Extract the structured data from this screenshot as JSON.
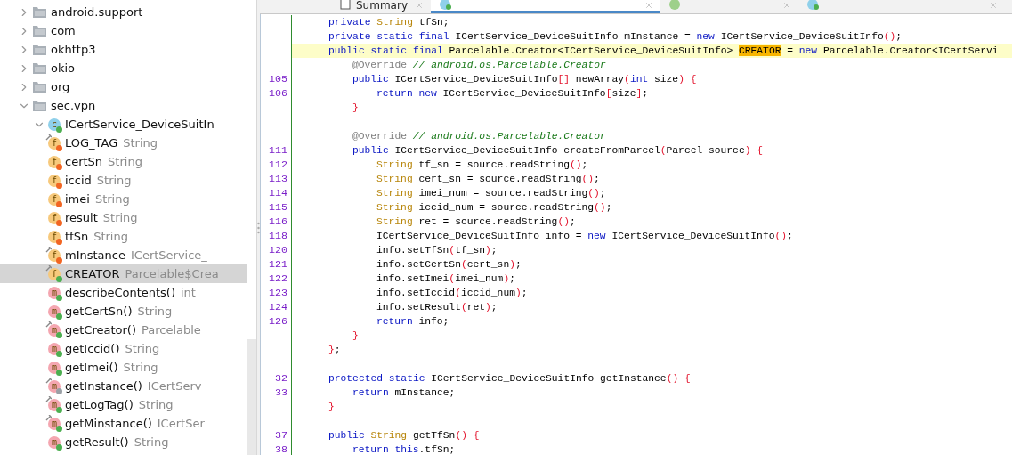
{
  "project_tree": [
    {
      "kind": "package",
      "label": "android.support",
      "expanded": false
    },
    {
      "kind": "package",
      "label": "com",
      "expanded": false
    },
    {
      "kind": "package",
      "label": "okhttp3",
      "expanded": false
    },
    {
      "kind": "package",
      "label": "okio",
      "expanded": false
    },
    {
      "kind": "package",
      "label": "org",
      "expanded": false
    },
    {
      "kind": "package",
      "label": "sec.vpn",
      "expanded": true,
      "children": [
        {
          "kind": "class",
          "label": "ICertService_DeviceSuitIn",
          "letter": "c",
          "color": "#4caf50",
          "expanded": true,
          "children": [
            {
              "kind": "field",
              "letter": "f",
              "label": "LOG_TAG",
              "type": "String",
              "static": true,
              "color": "#f26522",
              "selected": false
            },
            {
              "kind": "field",
              "letter": "f",
              "label": "certSn",
              "type": "String",
              "static": false,
              "color": "#f26522",
              "selected": false
            },
            {
              "kind": "field",
              "letter": "f",
              "label": "iccid",
              "type": "String",
              "static": false,
              "color": "#f26522",
              "selected": false
            },
            {
              "kind": "field",
              "letter": "f",
              "label": "imei",
              "type": "String",
              "static": false,
              "color": "#f26522",
              "selected": false
            },
            {
              "kind": "field",
              "letter": "f",
              "label": "result",
              "type": "String",
              "static": false,
              "color": "#f26522",
              "selected": false
            },
            {
              "kind": "field",
              "letter": "f",
              "label": "tfSn",
              "type": "String",
              "static": false,
              "color": "#f26522",
              "selected": false
            },
            {
              "kind": "field",
              "letter": "f",
              "label": "mInstance",
              "type": "ICertService_",
              "static": true,
              "color": "#f26522",
              "selected": false
            },
            {
              "kind": "field",
              "letter": "f",
              "label": "CREATOR",
              "type": "Parcelable$Crea",
              "static": true,
              "color": "#4caf50",
              "selected": true
            },
            {
              "kind": "method",
              "letter": "m",
              "label": "describeContents()",
              "type": "int",
              "static": false,
              "color": "#4caf50",
              "selected": false
            },
            {
              "kind": "method",
              "letter": "m",
              "label": "getCertSn()",
              "type": "String",
              "static": false,
              "color": "#4caf50",
              "selected": false
            },
            {
              "kind": "method",
              "letter": "m",
              "label": "getCreator()",
              "type": "Parcelable",
              "static": true,
              "color": "#4caf50",
              "selected": false
            },
            {
              "kind": "method",
              "letter": "m",
              "label": "getIccid()",
              "type": "String",
              "static": false,
              "color": "#4caf50",
              "selected": false
            },
            {
              "kind": "method",
              "letter": "m",
              "label": "getImei()",
              "type": "String",
              "static": false,
              "color": "#4caf50",
              "selected": false
            },
            {
              "kind": "method",
              "letter": "m",
              "label": "getInstance()",
              "type": "ICertServ",
              "static": true,
              "color": "#9aa0a6",
              "selected": false
            },
            {
              "kind": "method",
              "letter": "m",
              "label": "getLogTag()",
              "type": "String",
              "static": true,
              "color": "#4caf50",
              "selected": false
            },
            {
              "kind": "method",
              "letter": "m",
              "label": "getMinstance()",
              "type": "ICertSer",
              "static": true,
              "color": "#4caf50",
              "selected": false
            },
            {
              "kind": "method",
              "letter": "m",
              "label": "getResult()",
              "type": "String",
              "static": false,
              "color": "#4caf50",
              "selected": false
            }
          ]
        }
      ]
    }
  ],
  "editor_tabs": [
    {
      "kind": "document",
      "label": "Summary",
      "selected": false
    },
    {
      "kind": "class",
      "selected": true
    },
    {
      "kind": "progress",
      "selected": false
    },
    {
      "kind": "class",
      "selected": false
    }
  ],
  "code_lines": [
    {
      "kind": "code",
      "tokens": [
        {
          "kind": "keyword",
          "text": "private "
        },
        {
          "kind": "type",
          "text": "String "
        },
        {
          "kind": "plain",
          "text": "tfSn;"
        }
      ]
    },
    {
      "kind": "code",
      "tokens": [
        {
          "kind": "keyword",
          "text": "private static final "
        },
        {
          "kind": "plain",
          "text": "ICertService_DeviceSuitInfo mInstance = "
        },
        {
          "kind": "keyword",
          "text": "new "
        },
        {
          "kind": "plain",
          "text": "ICertService_DeviceSuitInfo"
        },
        {
          "kind": "bracket",
          "text": "()"
        },
        {
          "kind": "plain",
          "text": ";"
        }
      ]
    },
    {
      "kind": "code",
      "highlighted": true,
      "tokens": [
        {
          "kind": "keyword",
          "text": "public static final "
        },
        {
          "kind": "plain",
          "text": "Parcelable.Creator<ICertService_DeviceSuitInfo> "
        },
        {
          "kind": "match",
          "text": "CREATOR"
        },
        {
          "kind": "plain",
          "text": " = "
        },
        {
          "kind": "keyword",
          "text": "new "
        },
        {
          "kind": "plain",
          "text": "Parcelable.Creator<ICertServi"
        }
      ],
      "children": [
        {
          "kind": "code",
          "tokens": [
            {
              "kind": "annotation",
              "text": "@Override "
            },
            {
              "kind": "comment",
              "text": "// android.os.Parcelable.Creator"
            }
          ]
        },
        {
          "kind": "code",
          "number": "105",
          "tokens": [
            {
              "kind": "keyword",
              "text": "public "
            },
            {
              "kind": "plain",
              "text": "ICertService_DeviceSuitInfo"
            },
            {
              "kind": "bracket",
              "text": "[]"
            },
            {
              "kind": "plain",
              "text": " newArray"
            },
            {
              "kind": "bracket",
              "text": "("
            },
            {
              "kind": "keyword",
              "text": "int "
            },
            {
              "kind": "plain",
              "text": "size"
            },
            {
              "kind": "bracket",
              "text": ") {"
            }
          ],
          "children": [
            {
              "kind": "code",
              "number": "106",
              "tokens": [
                {
                  "kind": "keyword",
                  "text": "return new "
                },
                {
                  "kind": "plain",
                  "text": "ICertService_DeviceSuitInfo"
                },
                {
                  "kind": "bracket",
                  "text": "["
                },
                {
                  "kind": "plain",
                  "text": "size"
                },
                {
                  "kind": "bracket",
                  "text": "]"
                },
                {
                  "kind": "plain",
                  "text": ";"
                }
              ]
            }
          ]
        },
        {
          "kind": "code",
          "tokens": [
            {
              "kind": "bracket",
              "text": "}"
            }
          ]
        },
        {
          "kind": "blank"
        },
        {
          "kind": "code",
          "tokens": [
            {
              "kind": "annotation",
              "text": "@Override "
            },
            {
              "kind": "comment",
              "text": "// android.os.Parcelable.Creator"
            }
          ]
        },
        {
          "kind": "code",
          "number": "111",
          "tokens": [
            {
              "kind": "keyword",
              "text": "public "
            },
            {
              "kind": "plain",
              "text": "ICertService_DeviceSuitInfo createFromParcel"
            },
            {
              "kind": "bracket",
              "text": "("
            },
            {
              "kind": "plain",
              "text": "Parcel source"
            },
            {
              "kind": "bracket",
              "text": ") {"
            }
          ],
          "children": [
            {
              "kind": "code",
              "number": "112",
              "tokens": [
                {
                  "kind": "type",
                  "text": "String "
                },
                {
                  "kind": "plain",
                  "text": "tf_sn = source.readString"
                },
                {
                  "kind": "bracket",
                  "text": "()"
                },
                {
                  "kind": "plain",
                  "text": ";"
                }
              ]
            },
            {
              "kind": "code",
              "number": "113",
              "tokens": [
                {
                  "kind": "type",
                  "text": "String "
                },
                {
                  "kind": "plain",
                  "text": "cert_sn = source.readString"
                },
                {
                  "kind": "bracket",
                  "text": "()"
                },
                {
                  "kind": "plain",
                  "text": ";"
                }
              ]
            },
            {
              "kind": "code",
              "number": "114",
              "tokens": [
                {
                  "kind": "type",
                  "text": "String "
                },
                {
                  "kind": "plain",
                  "text": "imei_num = source.readString"
                },
                {
                  "kind": "bracket",
                  "text": "()"
                },
                {
                  "kind": "plain",
                  "text": ";"
                }
              ]
            },
            {
              "kind": "code",
              "number": "115",
              "tokens": [
                {
                  "kind": "type",
                  "text": "String "
                },
                {
                  "kind": "plain",
                  "text": "iccid_num = source.readString"
                },
                {
                  "kind": "bracket",
                  "text": "()"
                },
                {
                  "kind": "plain",
                  "text": ";"
                }
              ]
            },
            {
              "kind": "code",
              "number": "116",
              "tokens": [
                {
                  "kind": "type",
                  "text": "String "
                },
                {
                  "kind": "plain",
                  "text": "ret = source.readString"
                },
                {
                  "kind": "bracket",
                  "text": "()"
                },
                {
                  "kind": "plain",
                  "text": ";"
                }
              ]
            },
            {
              "kind": "code",
              "number": "118",
              "tokens": [
                {
                  "kind": "plain",
                  "text": "ICertService_DeviceSuitInfo info = "
                },
                {
                  "kind": "keyword",
                  "text": "new "
                },
                {
                  "kind": "plain",
                  "text": "ICertService_DeviceSuitInfo"
                },
                {
                  "kind": "bracket",
                  "text": "()"
                },
                {
                  "kind": "plain",
                  "text": ";"
                }
              ]
            },
            {
              "kind": "code",
              "number": "120",
              "tokens": [
                {
                  "kind": "plain",
                  "text": "info.setTfSn"
                },
                {
                  "kind": "bracket",
                  "text": "("
                },
                {
                  "kind": "plain",
                  "text": "tf_sn"
                },
                {
                  "kind": "bracket",
                  "text": ")"
                },
                {
                  "kind": "plain",
                  "text": ";"
                }
              ]
            },
            {
              "kind": "code",
              "number": "121",
              "tokens": [
                {
                  "kind": "plain",
                  "text": "info.setCertSn"
                },
                {
                  "kind": "bracket",
                  "text": "("
                },
                {
                  "kind": "plain",
                  "text": "cert_sn"
                },
                {
                  "kind": "bracket",
                  "text": ")"
                },
                {
                  "kind": "plain",
                  "text": ";"
                }
              ]
            },
            {
              "kind": "code",
              "number": "122",
              "tokens": [
                {
                  "kind": "plain",
                  "text": "info.setImei"
                },
                {
                  "kind": "bracket",
                  "text": "("
                },
                {
                  "kind": "plain",
                  "text": "imei_num"
                },
                {
                  "kind": "bracket",
                  "text": ")"
                },
                {
                  "kind": "plain",
                  "text": ";"
                }
              ]
            },
            {
              "kind": "code",
              "number": "123",
              "tokens": [
                {
                  "kind": "plain",
                  "text": "info.setIccid"
                },
                {
                  "kind": "bracket",
                  "text": "("
                },
                {
                  "kind": "plain",
                  "text": "iccid_num"
                },
                {
                  "kind": "bracket",
                  "text": ")"
                },
                {
                  "kind": "plain",
                  "text": ";"
                }
              ]
            },
            {
              "kind": "code",
              "number": "124",
              "tokens": [
                {
                  "kind": "plain",
                  "text": "info.setResult"
                },
                {
                  "kind": "bracket",
                  "text": "("
                },
                {
                  "kind": "plain",
                  "text": "ret"
                },
                {
                  "kind": "bracket",
                  "text": ")"
                },
                {
                  "kind": "plain",
                  "text": ";"
                }
              ]
            },
            {
              "kind": "code",
              "number": "126",
              "tokens": [
                {
                  "kind": "keyword",
                  "text": "return "
                },
                {
                  "kind": "plain",
                  "text": "info;"
                }
              ]
            }
          ]
        },
        {
          "kind": "code",
          "tokens": [
            {
              "kind": "bracket",
              "text": "}"
            }
          ]
        }
      ]
    },
    {
      "kind": "code",
      "tokens": [
        {
          "kind": "bracket",
          "text": "}"
        },
        {
          "kind": "plain",
          "text": ";"
        }
      ]
    },
    {
      "kind": "blank"
    },
    {
      "kind": "code",
      "number": "32",
      "tokens": [
        {
          "kind": "keyword",
          "text": "protected static "
        },
        {
          "kind": "plain",
          "text": "ICertService_DeviceSuitInfo getInstance"
        },
        {
          "kind": "bracket",
          "text": "() {"
        }
      ],
      "children": [
        {
          "kind": "code",
          "number": "33",
          "tokens": [
            {
              "kind": "keyword",
              "text": "return "
            },
            {
              "kind": "plain",
              "text": "mInstance;"
            }
          ]
        }
      ]
    },
    {
      "kind": "code",
      "tokens": [
        {
          "kind": "bracket",
          "text": "}"
        }
      ]
    },
    {
      "kind": "blank"
    },
    {
      "kind": "code",
      "number": "37",
      "tokens": [
        {
          "kind": "keyword",
          "text": "public "
        },
        {
          "kind": "type",
          "text": "String "
        },
        {
          "kind": "plain",
          "text": "getTfSn"
        },
        {
          "kind": "bracket",
          "text": "() {"
        }
      ],
      "children": [
        {
          "kind": "code",
          "number": "38",
          "tokens": [
            {
              "kind": "keyword",
              "text": "return this"
            },
            {
              "kind": "plain",
              "text": ".tfSn;"
            }
          ]
        }
      ]
    }
  ]
}
